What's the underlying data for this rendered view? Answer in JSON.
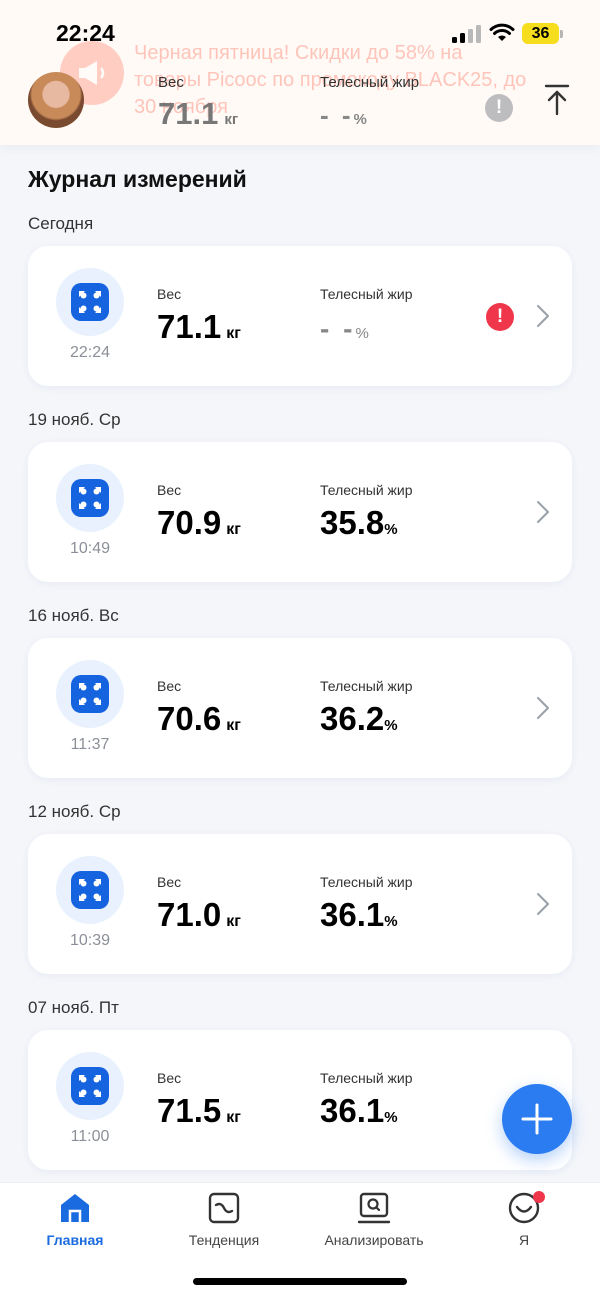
{
  "status_bar": {
    "time": "22:24",
    "battery": "36"
  },
  "header": {
    "promo_text": "Черная пятница! Скидки до 58% на товары Picooc по промокоду BLACK25, до 30 ноября",
    "weight_label": "Вес",
    "weight_value": "71.1",
    "weight_unit": "кг",
    "fat_label": "Телесный жир",
    "fat_value": "- -",
    "fat_unit": "%",
    "alert_symbol": "!"
  },
  "log": {
    "title": "Журнал измерений",
    "groups": [
      {
        "date": "Сегодня",
        "time": "22:24",
        "weight_label": "Вес",
        "weight": "71.1",
        "weight_unit": "кг",
        "fat_label": "Телесный жир",
        "fat": "- -",
        "fat_unit": "%",
        "alert": "!"
      },
      {
        "date": "19 нояб. Ср",
        "time": "10:49",
        "weight_label": "Вес",
        "weight": "70.9",
        "weight_unit": "кг",
        "fat_label": "Телесный жир",
        "fat": "35.8",
        "fat_unit": "%"
      },
      {
        "date": "16 нояб. Вс",
        "time": "11:37",
        "weight_label": "Вес",
        "weight": "70.6",
        "weight_unit": "кг",
        "fat_label": "Телесный жир",
        "fat": "36.2",
        "fat_unit": "%"
      },
      {
        "date": "12 нояб. Ср",
        "time": "10:39",
        "weight_label": "Вес",
        "weight": "71.0",
        "weight_unit": "кг",
        "fat_label": "Телесный жир",
        "fat": "36.1",
        "fat_unit": "%"
      },
      {
        "date": "07 нояб. Пт",
        "time": "11:00",
        "weight_label": "Вес",
        "weight": "71.5",
        "weight_unit": "кг",
        "fat_label": "Телесный жир",
        "fat": "36.1",
        "fat_unit": "%"
      }
    ]
  },
  "fab": {
    "icon": "plus-icon"
  },
  "bottom_nav": {
    "items": [
      {
        "label": "Главная",
        "icon": "home-icon",
        "active": true
      },
      {
        "label": "Тенденция",
        "icon": "trend-icon"
      },
      {
        "label": "Анализировать",
        "icon": "analyze-icon"
      },
      {
        "label": "Я",
        "icon": "profile-icon",
        "badge": true
      }
    ]
  },
  "colors": {
    "accent": "#2a7cf0",
    "alert_red": "#f0364a",
    "promo": "#ff3a1f"
  }
}
